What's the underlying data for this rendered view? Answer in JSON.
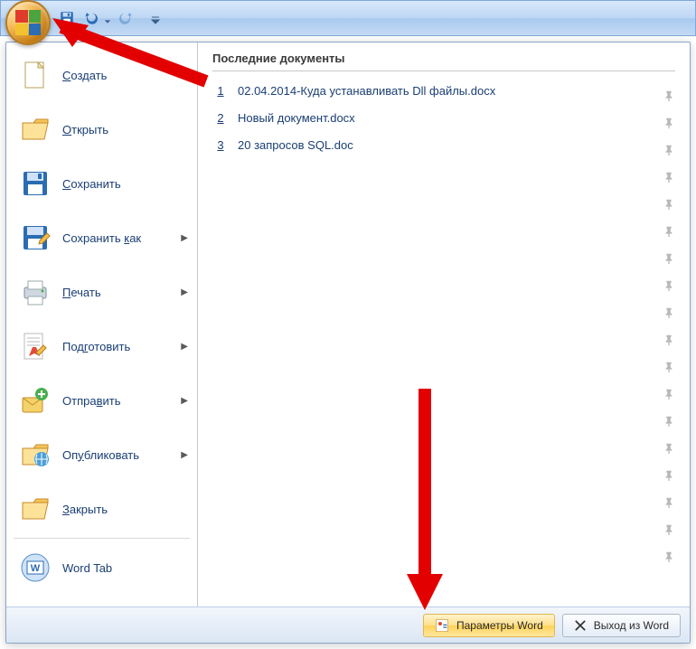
{
  "qat": {
    "save_title": "Сохранить",
    "undo_title": "Отменить",
    "redo_title": "Повторить"
  },
  "menu": {
    "items": [
      {
        "label_pre": "",
        "ul": "С",
        "label_post": "оздать",
        "has_arrow": false,
        "icon": "new"
      },
      {
        "label_pre": "",
        "ul": "О",
        "label_post": "ткрыть",
        "has_arrow": false,
        "icon": "open"
      },
      {
        "label_pre": "",
        "ul": "С",
        "label_post": "охранить",
        "has_arrow": false,
        "icon": "save"
      },
      {
        "label_pre": "Сохранить ",
        "ul": "к",
        "label_post": "ак",
        "has_arrow": true,
        "icon": "saveas"
      },
      {
        "label_pre": "",
        "ul": "П",
        "label_post": "ечать",
        "has_arrow": true,
        "icon": "print"
      },
      {
        "label_pre": "Под",
        "ul": "г",
        "label_post": "отовить",
        "has_arrow": true,
        "icon": "prepare"
      },
      {
        "label_pre": "Отпра",
        "ul": "в",
        "label_post": "ить",
        "has_arrow": true,
        "icon": "send"
      },
      {
        "label_pre": "Оп",
        "ul": "у",
        "label_post": "бликовать",
        "has_arrow": true,
        "icon": "publish"
      },
      {
        "label_pre": "",
        "ul": "З",
        "label_post": "акрыть",
        "has_arrow": false,
        "icon": "close"
      },
      {
        "label_pre": "Word Tab",
        "ul": "",
        "label_post": "",
        "has_arrow": false,
        "icon": "wordtab"
      }
    ]
  },
  "recent": {
    "header": "Последние документы",
    "docs": [
      {
        "num": "1",
        "name": "02.04.2014-Куда устанавливать Dll файлы.docx"
      },
      {
        "num": "2",
        "name": "Новый документ.docx"
      },
      {
        "num": "3",
        "name": "20 запросов SQL.doc"
      }
    ],
    "extra_pins": 15
  },
  "footer": {
    "options_label": "Параметры Word",
    "exit_label": "Выход из Word"
  }
}
